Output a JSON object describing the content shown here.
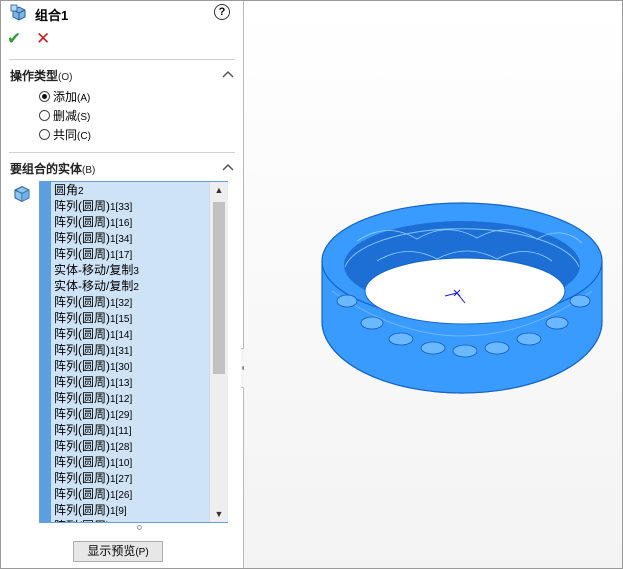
{
  "window": {
    "title": "组合1"
  },
  "header": {
    "ok_icon": "check-icon",
    "cancel_icon": "close-icon",
    "help_icon": "help-icon",
    "help_glyph": "?"
  },
  "operation_type": {
    "title": "操作类型",
    "key": "(O)",
    "options": [
      {
        "label": "添加",
        "key": "(A)",
        "selected": true
      },
      {
        "label": "删减",
        "key": "(S)",
        "selected": false
      },
      {
        "label": "共同",
        "key": "(C)",
        "selected": false
      }
    ]
  },
  "bodies": {
    "title": "要组合的实体",
    "key": "(B)",
    "items": [
      {
        "name": "圆角",
        "suffix": "2"
      },
      {
        "name": "阵列(圆周)",
        "suffix": "1[33]"
      },
      {
        "name": "阵列(圆周)",
        "suffix": "1[16]"
      },
      {
        "name": "阵列(圆周)",
        "suffix": "1[34]"
      },
      {
        "name": "阵列(圆周)",
        "suffix": "1[17]"
      },
      {
        "name": "实体-移动/复制",
        "suffix": "3"
      },
      {
        "name": "实体-移动/复制",
        "suffix": "2"
      },
      {
        "name": "阵列(圆周)",
        "suffix": "1[32]"
      },
      {
        "name": "阵列(圆周)",
        "suffix": "1[15]"
      },
      {
        "name": "阵列(圆周)",
        "suffix": "1[14]"
      },
      {
        "name": "阵列(圆周)",
        "suffix": "1[31]"
      },
      {
        "name": "阵列(圆周)",
        "suffix": "1[30]"
      },
      {
        "name": "阵列(圆周)",
        "suffix": "1[13]"
      },
      {
        "name": "阵列(圆周)",
        "suffix": "1[12]"
      },
      {
        "name": "阵列(圆周)",
        "suffix": "1[29]"
      },
      {
        "name": "阵列(圆周)",
        "suffix": "1[11]"
      },
      {
        "name": "阵列(圆周)",
        "suffix": "1[28]"
      },
      {
        "name": "阵列(圆周)",
        "suffix": "1[10]"
      },
      {
        "name": "阵列(圆周)",
        "suffix": "1[27]"
      },
      {
        "name": "阵列(圆周)",
        "suffix": "1[26]"
      },
      {
        "name": "阵列(圆周)",
        "suffix": "1[9]"
      },
      {
        "name": "阵列(圆周)",
        "suffix": ""
      }
    ]
  },
  "preview_button": {
    "label": "显示预览",
    "key": "(P)"
  },
  "colors": {
    "model_blue": "#3a9bff",
    "list_bg": "#cfe3f7",
    "accent": "#5b9fe0"
  }
}
